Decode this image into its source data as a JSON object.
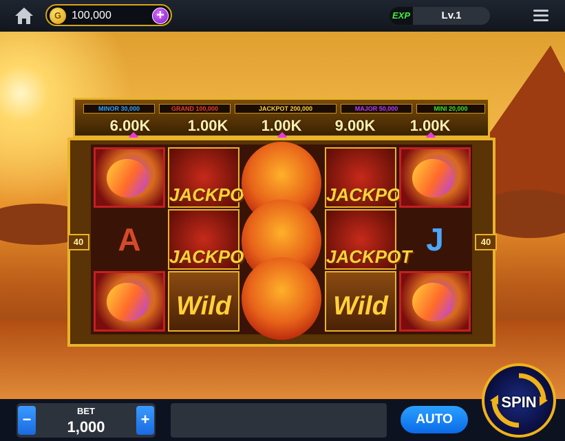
{
  "topbar": {
    "coins": "100,000",
    "coin_glyph": "G",
    "plus": "+",
    "exp_tag": "EXP",
    "level": "Lv.1"
  },
  "jackpots": [
    {
      "name": "MINOR",
      "value": "30,000",
      "color": "#2aa0ff"
    },
    {
      "name": "GRAND",
      "value": "100,000",
      "color": "#e83a2a"
    },
    {
      "name": "JACKPOT",
      "value": "200,000",
      "color": "#ffd23a"
    },
    {
      "name": "MAJOR",
      "value": "50,000",
      "color": "#b23aff"
    },
    {
      "name": "MINI",
      "value": "20,000",
      "color": "#3ae02a"
    }
  ],
  "reel_values": [
    "6.00K",
    "1.00K",
    "1.00K",
    "9.00K",
    "1.00K"
  ],
  "symbols": {
    "a": "A",
    "j": "J",
    "jackpot": "JACKPOT",
    "wild": "Wild",
    "multiplier": "40"
  },
  "bet": {
    "label": "BET",
    "value": "1,000",
    "minus": "−",
    "plus": "+"
  },
  "auto_label": "AUTO",
  "spin_label": "SPIN",
  "colors": {
    "gold": "#e8b42a",
    "button_blue": "#1a6ae0",
    "exp_green": "#3ef03a"
  }
}
